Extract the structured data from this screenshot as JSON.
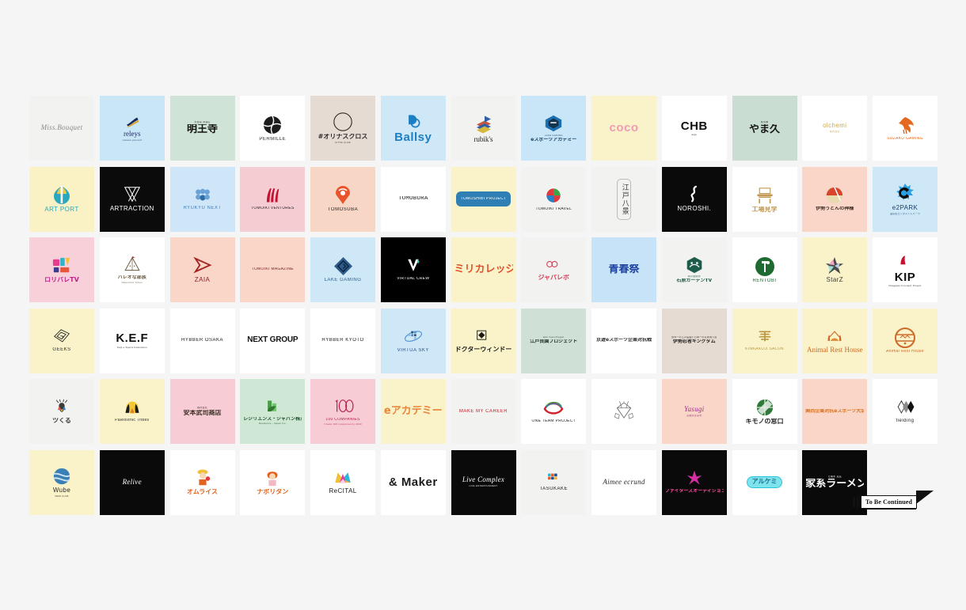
{
  "page": {
    "background": "#f5f5f5",
    "grid_columns": 13,
    "grid_rows": 6,
    "total_tiles": 78
  },
  "banner": {
    "label": "To Be Continued",
    "name": "to-be-continued-banner"
  },
  "tiles": [
    {
      "id": "miss-bouquet",
      "name": "Miss.Bouquet",
      "bg": "#f2f2f0",
      "fg": "#8a8a88",
      "style": "w-script"
    },
    {
      "id": "releys",
      "name": "releys",
      "sub": "release yourself",
      "bg": "#c9e6f7",
      "fg": "#1a2a5e",
      "style": "w-serif",
      "mark": "swoosh"
    },
    {
      "id": "myouou-ji",
      "name": "明王寺",
      "sub": "天台宗 清涼山",
      "bg": "#cfe3d6",
      "fg": "#14110f",
      "style": "w-cjk"
    },
    {
      "id": "permille",
      "name": "PERMILLE",
      "bg": "#ffffff",
      "fg": "#2b2b2b",
      "style": "w-sans-sm",
      "mark": "circle-split"
    },
    {
      "id": "orinas-cross",
      "name": "#オリナスクロス",
      "sub": "KITTE CLUB",
      "bg": "#e6dbd2",
      "fg": "#2b2b2b",
      "style": "w-cjk-sm",
      "mark": "ring"
    },
    {
      "id": "ballsy",
      "name": "Ballsy",
      "bg": "#cfe8f8",
      "fg": "#1d7fc2",
      "style": "w-big",
      "mark": "ball"
    },
    {
      "id": "rubiks",
      "name": "rubik's",
      "bg": "#f2f2f0",
      "fg": "#1b1b1b",
      "style": "w-serif",
      "mark": "stack"
    },
    {
      "id": "lake-gaming-academy",
      "name": "eスポーツアカデミー",
      "sub": "LAKE GAMING",
      "bg": "#c9e6f8",
      "fg": "#113f63",
      "style": "w-cjk-xs",
      "mark": "gcube"
    },
    {
      "id": "coco",
      "name": "coco",
      "bg": "#faf3c9",
      "fg": "#ef9bb4",
      "style": "w-big"
    },
    {
      "id": "chb-arge",
      "name": "CHB",
      "sub": "arge",
      "bg": "#ffffff",
      "fg": "#111111",
      "style": "w-big"
    },
    {
      "id": "yamaq",
      "name": "やま久",
      "sub": "魚河岸",
      "bg": "#c9ddd2",
      "fg": "#1a1a18",
      "style": "w-cjk"
    },
    {
      "id": "olchemi",
      "name": "olchemi",
      "sub": "株式会社",
      "bg": "#ffffff",
      "fg": "#c9a84c",
      "style": "w-sans"
    },
    {
      "id": "suzaku-gaming",
      "name": "SUZAKU GAMING",
      "bg": "#ffffff",
      "fg": "#e2691f",
      "style": "w-sans-xs",
      "mark": "phoenix"
    },
    {
      "id": "art-port",
      "name": "ART PORT",
      "bg": "#faf2c4",
      "fg": "#2aa8bf",
      "style": "w-sans",
      "mark": "artport"
    },
    {
      "id": "artraction",
      "name": "ARTRACTION",
      "bg": "#0b0b0b",
      "fg": "#ffffff",
      "style": "w-sans",
      "mark": "artraction"
    },
    {
      "id": "ryukyu-next",
      "name": "RYUKYU NEXT",
      "bg": "#cfe6f8",
      "fg": "#3d7fbf",
      "style": "w-sans-sm",
      "mark": "dots"
    },
    {
      "id": "tomoiki-ventures",
      "name": "TOMOIKI VENTURES",
      "bg": "#f6ccd3",
      "fg": "#1d1d1d",
      "style": "w-sans-xs",
      "mark": "flame-red"
    },
    {
      "id": "tomosuba",
      "name": "TOMOSUBA",
      "bg": "#f8d6c6",
      "fg": "#1d1d1d",
      "style": "w-sans-sm",
      "mark": "pin"
    },
    {
      "id": "tomobura",
      "name": "TOMOBURA",
      "bg": "#ffffff",
      "fg": "#1b1b1b",
      "style": "w-mono"
    },
    {
      "id": "tomoshibi-project",
      "name": "TOMOSHIBI PROJECT",
      "bg": "#faf3c9",
      "fg": "#ffffff",
      "style": "w-sans-xs",
      "mark": "bluebox"
    },
    {
      "id": "tomoiki-travel",
      "name": "TOMOIKI TRAVEL",
      "bg": "#f2f2f0",
      "fg": "#1d1d1d",
      "style": "w-sans-xs",
      "mark": "globe"
    },
    {
      "id": "edo-hakkei",
      "name": "江戸八景",
      "bg": "#f2f2f0",
      "fg": "#3a3a3a",
      "style": "vert-cjk",
      "mark": "frame"
    },
    {
      "id": "noroshi",
      "name": "NOROSHI.",
      "bg": "#0a0a0a",
      "fg": "#ffffff",
      "style": "w-sans",
      "mark": "smoke"
    },
    {
      "id": "koujou-kengaku",
      "name": "工場見学",
      "bg": "#ffffff",
      "fg": "#c39a54",
      "style": "w-cjk-sm",
      "mark": "factory"
    },
    {
      "id": "ise-udon",
      "name": "伊勢うどんの神様",
      "bg": "#f9d6c7",
      "fg": "#3a2a22",
      "style": "w-cjk-xs",
      "mark": "sun-circle"
    },
    {
      "id": "e2park",
      "name": "e2PARK",
      "sub": "温泉街エンタメントパーク",
      "bg": "#cfe8f8",
      "fg": "#1b3f66",
      "style": "w-sans",
      "mark": "splash-c"
    },
    {
      "id": "roribare-tv",
      "name": "ロリバレTV",
      "bg": "#f7d0da",
      "fg": "#c5208a",
      "style": "w-cjk-sm",
      "mark": "poptv"
    },
    {
      "id": "paleolithic-tribes",
      "name": "パレオな部族",
      "sub": "Paleolithic Tribes",
      "bg": "#ffffff",
      "fg": "#6b5a3e",
      "style": "w-cjk-xs",
      "mark": "tent"
    },
    {
      "id": "zaia",
      "name": "ZAIA",
      "bg": "#f9d6c7",
      "fg": "#8c1f1f",
      "style": "w-sans",
      "mark": "tri-arrow"
    },
    {
      "id": "tomoiki-magazine",
      "name": "TOMOIKI MAGAZINE",
      "bg": "#f9d6c7",
      "fg": "#7a2020",
      "style": "w-sans-xs"
    },
    {
      "id": "lake-gaming",
      "name": "LAKE GAMING",
      "bg": "#cfe8f8",
      "fg": "#2e5c8a",
      "style": "w-sans-sm",
      "mark": "diamond-maze"
    },
    {
      "id": "virtual-crew",
      "name": "VIRTUAL CREW",
      "bg": "#000000",
      "fg": "#ffffff",
      "style": "w-sans-xs",
      "mark": "vmark"
    },
    {
      "id": "miricollege",
      "name": "ミリカレッジ",
      "bg": "#faf3c9",
      "fg": "#e2512c",
      "style": "w-cjk"
    },
    {
      "id": "japalabo",
      "name": "ジャパレボ",
      "bg": "#f2f2f0",
      "fg": "#d4435a",
      "style": "w-cjk-sm",
      "mark": "jp-mark"
    },
    {
      "id": "seishun-sai",
      "name": "青春祭",
      "bg": "#c6e3f7",
      "fg": "#1b3fa0",
      "style": "w-cjk"
    },
    {
      "id": "midori-mahoukan",
      "name": "石原ガーデンTV",
      "sub": "緑の魔術師",
      "bg": "#f2f2f0",
      "fg": "#1d5c4a",
      "style": "w-cjk-xs",
      "mark": "hex-leaf"
    },
    {
      "id": "rentobi",
      "name": "RENTOBI",
      "bg": "#ffffff",
      "fg": "#1d6b31",
      "style": "w-sans-sm",
      "mark": "green-circle"
    },
    {
      "id": "starz",
      "name": "StarZ",
      "bg": "#faf3c9",
      "fg": "#3a3a3a",
      "style": "w-sans",
      "mark": "star"
    },
    {
      "id": "kip",
      "name": "KIP",
      "sub": "Kitagawa Innovator Project",
      "bg": "#ffffff",
      "fg": "#111111",
      "style": "w-big",
      "mark": "red-drop"
    },
    {
      "id": "geeks",
      "name": "GEEKS",
      "bg": "#faf3c9",
      "fg": "#2b2b2b",
      "style": "w-sans-sm",
      "mark": "gbox"
    },
    {
      "id": "kef",
      "name": "K.E.F",
      "sub": "Keiji e-Sports Federation",
      "bg": "#ffffff",
      "fg": "#111111",
      "style": "w-big"
    },
    {
      "id": "hybber-osaka",
      "name": "HYBBER OSAKA",
      "bg": "#ffffff",
      "fg": "#1b1b1b",
      "style": "w-sans-sm"
    },
    {
      "id": "next-group",
      "name": "NEXT GROUP",
      "bg": "#ffffff",
      "fg": "#111111",
      "style": "w-cond"
    },
    {
      "id": "hybber-kyoto",
      "name": "HYBBER KYOTO",
      "bg": "#ffffff",
      "fg": "#1b1b1b",
      "style": "w-sans-sm"
    },
    {
      "id": "virtua-sky",
      "name": "VIRTUA SKY",
      "bg": "#cfe8f8",
      "fg": "#2a4f8f",
      "style": "w-sans-sm",
      "mark": "sky-orbit"
    },
    {
      "id": "doctor-window",
      "name": "ドクターウィンドー",
      "bg": "#faf3c9",
      "fg": "#1b1b1b",
      "style": "w-cjk-sm",
      "mark": "win-diamond"
    },
    {
      "id": "edo-ryoen",
      "name": "江戸良園プロジェクト",
      "sub": "Edo Yoen Project",
      "bg": "#cfe0d6",
      "fg": "#23332b",
      "style": "w-cjk-xs"
    },
    {
      "id": "kyo-esports",
      "name": "京遊eスポーツ企業対抗戦",
      "bg": "#ffffff",
      "fg": "#2b2b2b",
      "style": "w-cjk-xs"
    },
    {
      "id": "ise-ninja-kingdom",
      "name": "伊勢忍者キングダム",
      "sub": "世界一の江戸庭園と日本一の忍者城下街",
      "bg": "#e6dbd2",
      "fg": "#1d1d1d",
      "style": "w-cjk-xs"
    },
    {
      "id": "kinkakuji-salon",
      "name": "KINKAKUJI SALON",
      "bg": "#faf3c9",
      "fg": "#b8973f",
      "style": "w-sans-xs",
      "mark": "kinkaku"
    },
    {
      "id": "animal-rest-house",
      "name": "Animal Rest House",
      "bg": "#faf3c9",
      "fg": "#cc6a2a",
      "style": "w-serif",
      "mark": "pet-arch"
    },
    {
      "id": "animal-rest-house-2",
      "name": "Animal Rest House",
      "bg": "#faf3c9",
      "fg": "#cc6a2a",
      "style": "w-sans-xs",
      "mark": "pet-seal"
    },
    {
      "id": "tsukuru",
      "name": "ツくる",
      "bg": "#f2f2f0",
      "fg": "#3a3a3a",
      "style": "w-cjk-sm",
      "mark": "deer"
    },
    {
      "id": "paleolithic-tribes-2",
      "name": "Paleolithic Tribes",
      "bg": "#faf3c9",
      "fg": "#2b2b2b",
      "style": "w-sans-xs",
      "mark": "campfire"
    },
    {
      "id": "yasumoto-takeshi",
      "name": "安本武司商店",
      "sub": "株式会社",
      "bg": "#f7ccd4",
      "fg": "#3a2a22",
      "style": "w-cjk-sm"
    },
    {
      "id": "resilience-japan",
      "name": "レジリエンス・ジャパン株式会社",
      "sub": "Resilience - Japan Inc.",
      "bg": "#cfe8d6",
      "fg": "#1d4d2b",
      "style": "w-cjk-xs",
      "mark": "leafbldg"
    },
    {
      "id": "100-companies",
      "name": "100 COMPANIES",
      "sub": "Create 100 companies by 2040",
      "bg": "#f7ccd4",
      "fg": "#b8244a",
      "style": "w-sans-xs",
      "mark": "hundred"
    },
    {
      "id": "e-academy",
      "name": "eアカデミー",
      "bg": "#faf3c9",
      "fg": "#e8863a",
      "style": "w-cjk"
    },
    {
      "id": "make-my-career",
      "name": "MAKE MY CAREER",
      "bg": "#f2f2f0",
      "fg": "#c02028",
      "style": "w-sans-sm"
    },
    {
      "id": "one-team-project",
      "name": "ONE TEAM PROJECT",
      "bg": "#ffffff",
      "fg": "#1b1b1b",
      "style": "w-sans-xs",
      "mark": "oneteam"
    },
    {
      "id": "diamond-crest",
      "name": "",
      "bg": "#ffffff",
      "fg": "#555555",
      "style": "w-sans-xs",
      "mark": "crest"
    },
    {
      "id": "yasugi",
      "name": "Yasugi",
      "sub": "島根県安来市",
      "bg": "#f9d6c7",
      "fg": "#9b2f86",
      "style": "w-script"
    },
    {
      "id": "kimono-madoguchi",
      "name": "キモノの窓口",
      "bg": "#ffffff",
      "fg": "#1d1d1d",
      "style": "w-cjk-sm",
      "mark": "kimono-circle"
    },
    {
      "id": "kansai-esports",
      "name": "関西企業対抗eスポーツ大会",
      "bg": "#f9d6c7",
      "fg": "#d4711f",
      "style": "w-cjk-xs"
    },
    {
      "id": "fielding",
      "name": "fielding",
      "bg": "#ffffff",
      "fg": "#1b1b1b",
      "style": "w-sans-sm",
      "mark": "fielding"
    },
    {
      "id": "wube",
      "name": "Wube",
      "sub": "WEB CLUB",
      "bg": "#faf3c9",
      "fg": "#2b2b2b",
      "style": "w-sans",
      "mark": "wube-globe"
    },
    {
      "id": "relive",
      "name": "Relive",
      "bg": "#0a0a0a",
      "fg": "#ffffff",
      "style": "w-script"
    },
    {
      "id": "omurice",
      "name": "オムライス",
      "bg": "#ffffff",
      "fg": "#e0651f",
      "style": "w-cjk-sm",
      "mark": "omu-chef"
    },
    {
      "id": "napolitan",
      "name": "ナポリタン",
      "bg": "#ffffff",
      "fg": "#e0651f",
      "style": "w-cjk-sm",
      "mark": "napo-girl"
    },
    {
      "id": "recital",
      "name": "ReCITAL",
      "bg": "#ffffff",
      "fg": "#1b1b1b",
      "style": "w-sans",
      "mark": "crown"
    },
    {
      "id": "and-maker",
      "name": "& Maker",
      "bg": "#ffffff",
      "fg": "#1b1b1b",
      "style": "w-big"
    },
    {
      "id": "live-complex",
      "name": "Live Complex",
      "sub": "LIVE ENTERTAINMENT",
      "bg": "#0a0a0a",
      "fg": "#ffffff",
      "style": "w-script"
    },
    {
      "id": "tasukake",
      "name": "TASUKAKE",
      "bg": "#f2f2f0",
      "fg": "#1b1b1b",
      "style": "w-sans-sm",
      "mark": "checker"
    },
    {
      "id": "aimee-ecrund",
      "name": "Aimee ecrund",
      "bg": "#ffffff",
      "fg": "#2b2b2b",
      "style": "w-script"
    },
    {
      "id": "fighters-audition",
      "name": "ファイターズオーディション",
      "bg": "#0a0a0a",
      "fg": "#ff4fa3",
      "style": "w-cjk-xs",
      "mark": "fighters"
    },
    {
      "id": "alchemy",
      "name": "アルケミ",
      "bg": "#ffffff",
      "fg": "#1b6f87",
      "style": "pill"
    },
    {
      "id": "kazoku-ramen",
      "name": "家系ラーメン",
      "sub": "五福家 直品",
      "bg": "#0a0a0a",
      "fg": "#ffffff",
      "style": "w-cjk"
    },
    {
      "id": "empty-last",
      "name": "",
      "bg": "#f5f5f5",
      "fg": "#f5f5f5",
      "style": "w-sans-xs"
    }
  ]
}
